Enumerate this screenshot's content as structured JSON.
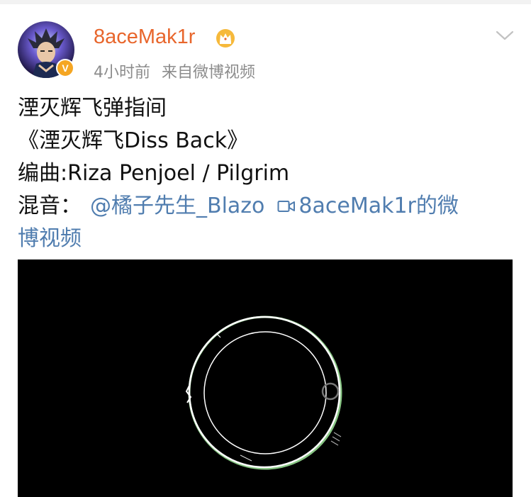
{
  "post": {
    "author": {
      "name": "8aceMak1r",
      "avatar_icon": "anime-character-avatar",
      "verified_badge": "V",
      "crown_icon": "crown-icon"
    },
    "time": "4小时前",
    "source": "来自微博视频",
    "menu_icon": "chevron-down-icon",
    "content": {
      "line1": "湮灭辉飞弹指间",
      "line2": "《湮灭辉飞Diss Back》",
      "line3": "编曲:Riza Penjoel / Pilgrim",
      "line4_label": "混音：",
      "mention": "@橘子先生_Blazo",
      "video_link_part1": "8aceMak1r的微",
      "video_link_part2": "博视频"
    },
    "video": {
      "background": "#000000",
      "visual": "audio-ring-visualizer"
    }
  },
  "colors": {
    "username": "#e8662c",
    "link": "#507daf",
    "meta": "#8c8c8c",
    "badge": "#f5a623"
  }
}
